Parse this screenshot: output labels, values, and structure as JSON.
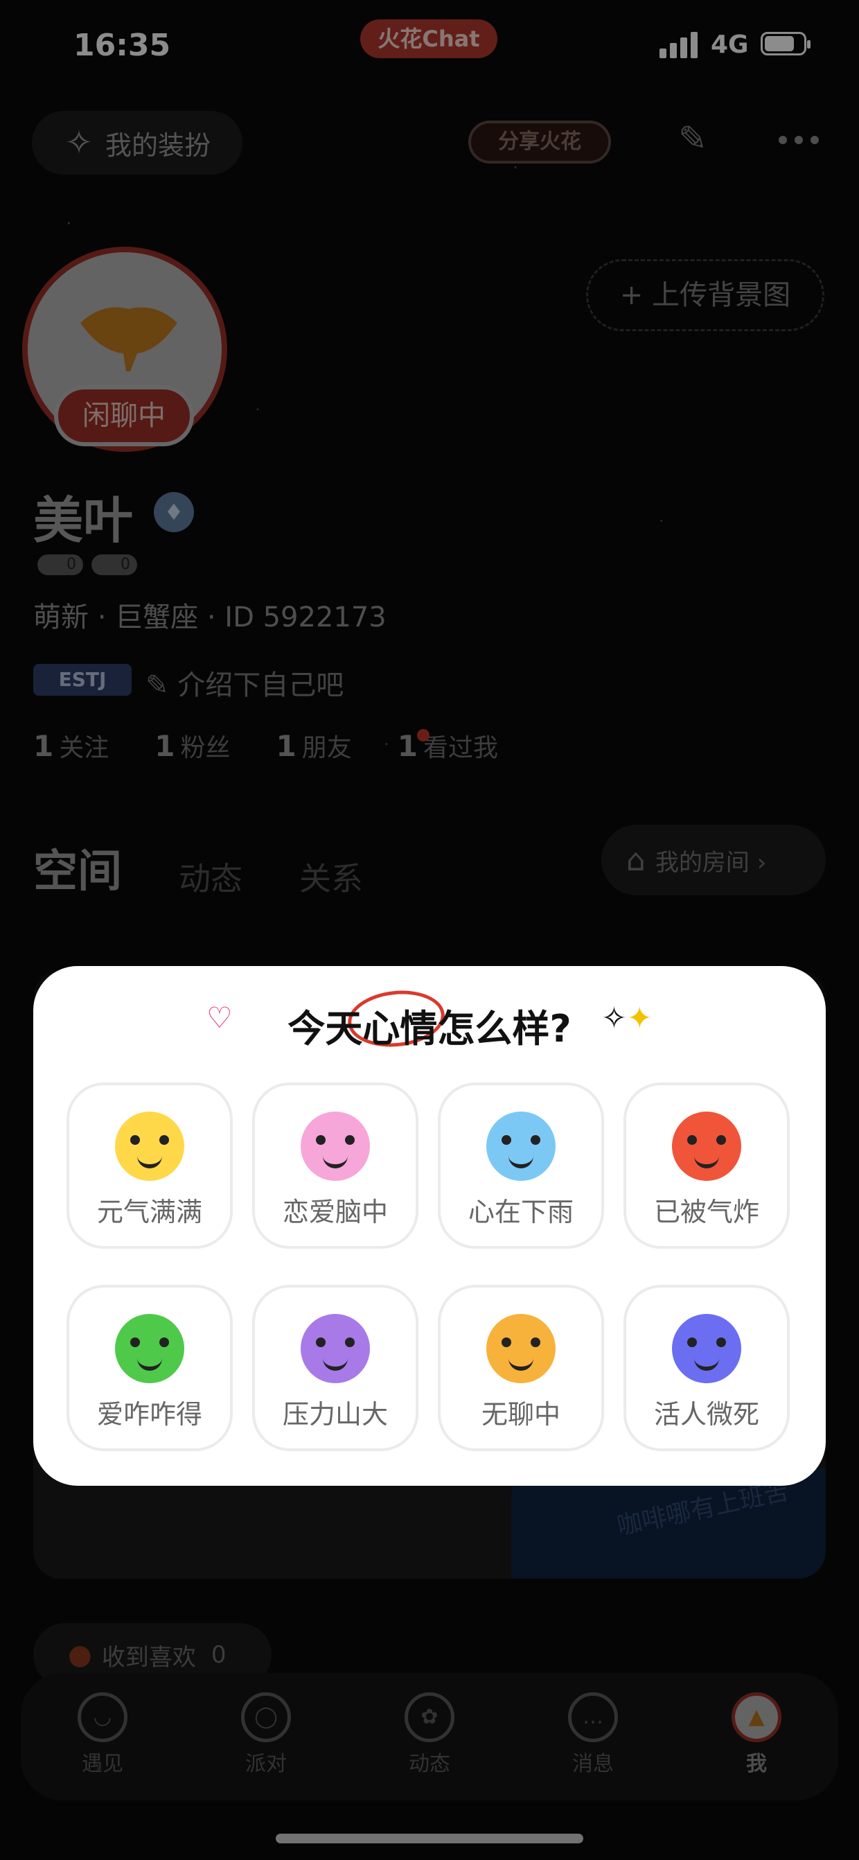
{
  "status_bar": {
    "time": "16:35",
    "app_pill": "火花Chat",
    "network": "4G"
  },
  "top_bar": {
    "dress_up": "我的装扮",
    "share": "分享火花"
  },
  "profile": {
    "upload_bg": "+ 上传背景图",
    "status_tag": "闲聊中",
    "name": "美叶",
    "mini_badges": [
      "0",
      "0"
    ],
    "meta": "萌新 · 巨蟹座 · ID 5922173",
    "mbti": "ESTJ",
    "intro": "介绍下自己吧",
    "counts": [
      {
        "n": "1",
        "label": "关注"
      },
      {
        "n": "1",
        "label": "粉丝"
      },
      {
        "n": "1",
        "label": "朋友"
      },
      {
        "n": "1",
        "label": "看过我"
      }
    ]
  },
  "tabs": [
    "空间",
    "动态",
    "关系"
  ],
  "room_button": "我的房间 ›",
  "background_card": {
    "promo_text": "咖啡哪有上班苦"
  },
  "likes": {
    "label": "收到喜欢",
    "value": "0"
  },
  "mood_modal": {
    "title": "今天心情怎么样?",
    "moods": [
      {
        "label": "元气满满",
        "color": "#ffd84a"
      },
      {
        "label": "恋爱脑中",
        "color": "#f7a6d9"
      },
      {
        "label": "心在下雨",
        "color": "#7cc8f5"
      },
      {
        "label": "已被气炸",
        "color": "#f0553a"
      },
      {
        "label": "爱咋咋得",
        "color": "#4fc94a"
      },
      {
        "label": "压力山大",
        "color": "#a77ae8"
      },
      {
        "label": "无聊中",
        "color": "#f7b23b"
      },
      {
        "label": "活人微死",
        "color": "#6b6ef0"
      }
    ]
  },
  "bottom_nav": [
    "遇见",
    "派对",
    "动态",
    "消息",
    "我"
  ]
}
